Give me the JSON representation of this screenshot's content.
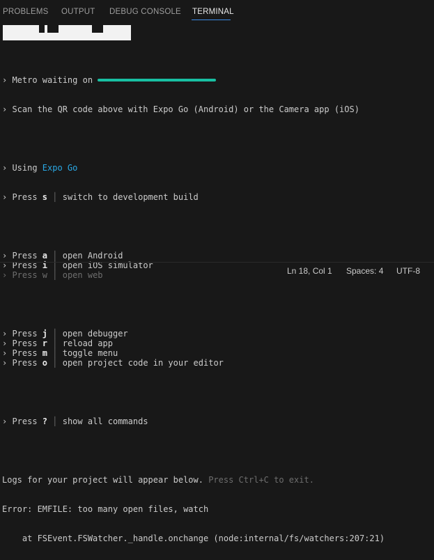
{
  "panel_tabs": [
    {
      "label": "PROBLEMS",
      "active": false
    },
    {
      "label": "OUTPUT",
      "active": false
    },
    {
      "label": "DEBUG CONSOLE",
      "active": false
    },
    {
      "label": "TERMINAL",
      "active": true
    }
  ],
  "terminal": {
    "metro_prefix": "› Metro waiting on ",
    "scan_line": "› Scan the QR code above with Expo Go (Android) or the Camera app (iOS)",
    "using_prefix": "› Using ",
    "using_value": "Expo Go",
    "press_prefix": "› Press ",
    "commands_group1": [
      {
        "key": "s",
        "label": "switch to development build",
        "disabled": false
      }
    ],
    "commands_group2": [
      {
        "key": "a",
        "label": "open Android",
        "disabled": false
      },
      {
        "key": "i",
        "label": "open iOS simulator",
        "disabled": false
      },
      {
        "key": "w",
        "label": "open web",
        "disabled": true
      }
    ],
    "commands_group3": [
      {
        "key": "j",
        "label": "open debugger",
        "disabled": false
      },
      {
        "key": "r",
        "label": "reload app",
        "disabled": false
      },
      {
        "key": "m",
        "label": "toggle menu",
        "disabled": false
      },
      {
        "key": "o",
        "label": "open project code in your editor",
        "disabled": false
      }
    ],
    "commands_group4": [
      {
        "key": "?",
        "label": "show all commands",
        "disabled": false
      }
    ],
    "logs_text": "Logs for your project will appear below.",
    "logs_hint": " Press Ctrl+C to exit.",
    "error_line": "Error: EMFILE: too many open files, watch",
    "stack_line": "    at FSEvent.FSWatcher._handle.onchange (node:internal/fs/watchers:207:21)",
    "redaction_color": "#18bfa2"
  },
  "status_bar": {
    "position": "Ln 18, Col 1",
    "spaces": "Spaces: 4",
    "encoding": "UTF-8"
  },
  "colors": {
    "background": "#181818",
    "active_tab_underline": "#3c8ce8",
    "link": "#2aa9e6"
  }
}
